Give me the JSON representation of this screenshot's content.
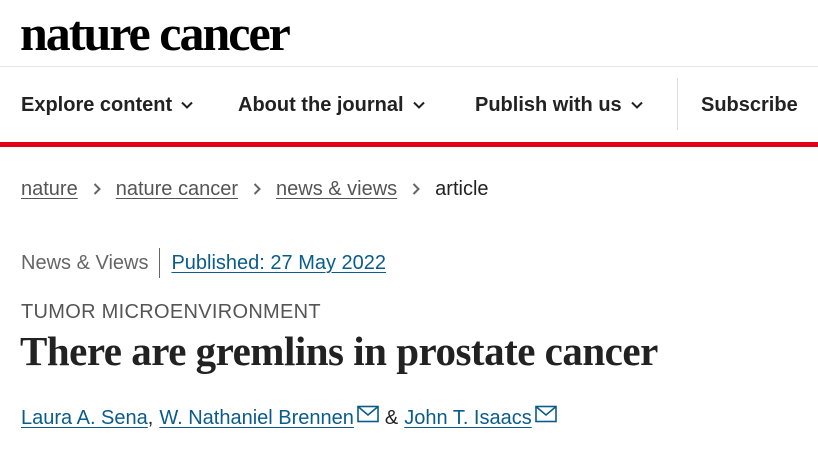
{
  "header": {
    "logo_text": "nature cancer"
  },
  "nav": {
    "items": [
      {
        "label": "Explore content",
        "icon": "chevron-down-icon"
      },
      {
        "label": "About the journal",
        "icon": "chevron-down-icon"
      },
      {
        "label": "Publish with us",
        "icon": "chevron-down-icon"
      }
    ],
    "subscribe_label": "Subscribe",
    "accent_color": "#e2001a"
  },
  "breadcrumb": {
    "items": [
      "nature",
      "nature cancer",
      "news & views"
    ],
    "current": "article",
    "separator_icon": "chevron-right-icon"
  },
  "article": {
    "type": "News & Views",
    "published": "Published: 27 May 2022",
    "subject": "TUMOR MICROENVIRONMENT",
    "title": "There are gremlins in prostate cancer",
    "authors": {
      "first": "Laura A. Sena",
      "comma": ",",
      "second": "W. Nathaniel Brennen",
      "ampersand": "&",
      "third": "John T. Isaacs",
      "contact_icon": "mail-icon"
    },
    "link_color": "#0a5c8a"
  }
}
